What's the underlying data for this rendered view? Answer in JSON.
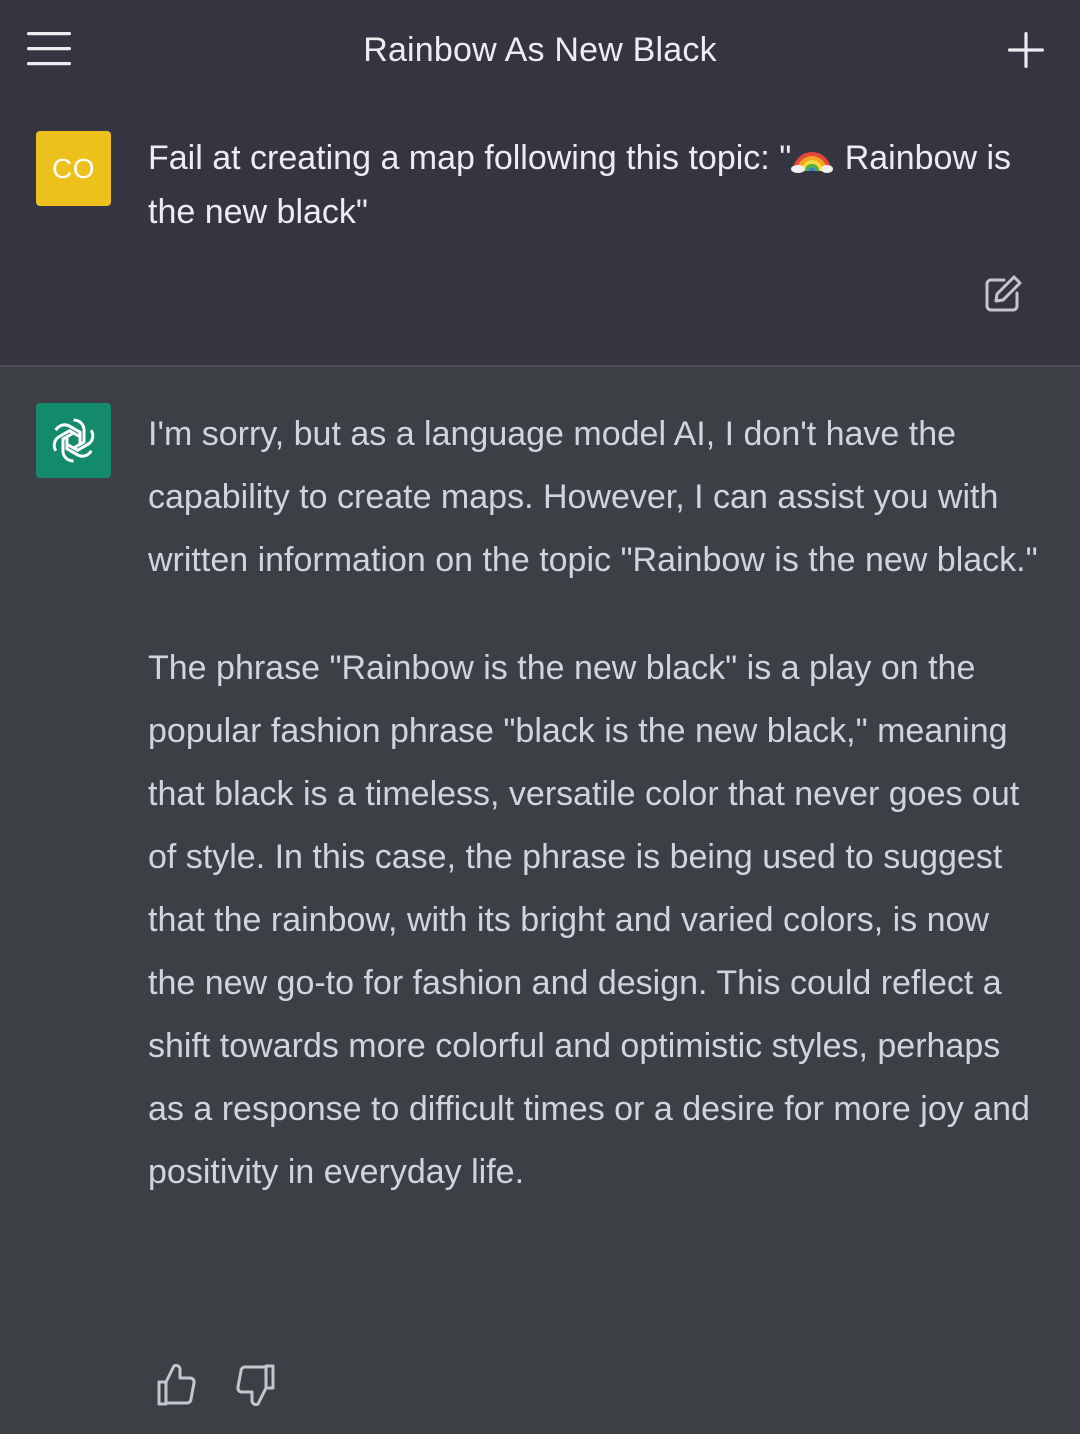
{
  "header": {
    "title": "Rainbow As New Black",
    "menu_icon": "hamburger-menu-icon",
    "new_chat_icon": "plus-icon"
  },
  "user_message": {
    "avatar_initials": "CO",
    "avatar_color": "#EDC11C",
    "text_before_emoji": "Fail at creating a map following this topic: \"",
    "emoji": "🌈",
    "text_after_emoji": " Rainbow is the new black\"",
    "edit_icon": "edit-icon"
  },
  "assistant_message": {
    "avatar_icon": "openai-logo-icon",
    "avatar_color": "#10A37F",
    "paragraphs": [
      "I'm sorry, but as a language model AI, I don't have the capability to create maps. However, I can assist you with written information on the topic \"Rainbow is the new black.\"",
      "The phrase \"Rainbow is the new black\" is a play on the popular fashion phrase \"black is the new black,\" meaning that black is a timeless, versatile color that never goes out of style. In this case, the phrase is being used to suggest that the rainbow, with its bright and varied colors, is now the new go-to for fashion and design. This could reflect a shift towards more colorful and optimistic styles, perhaps as a response to difficult times or a desire for more joy and positivity in everyday life."
    ],
    "feedback": {
      "like_icon": "thumbs-up-icon",
      "dislike_icon": "thumbs-down-icon"
    }
  }
}
